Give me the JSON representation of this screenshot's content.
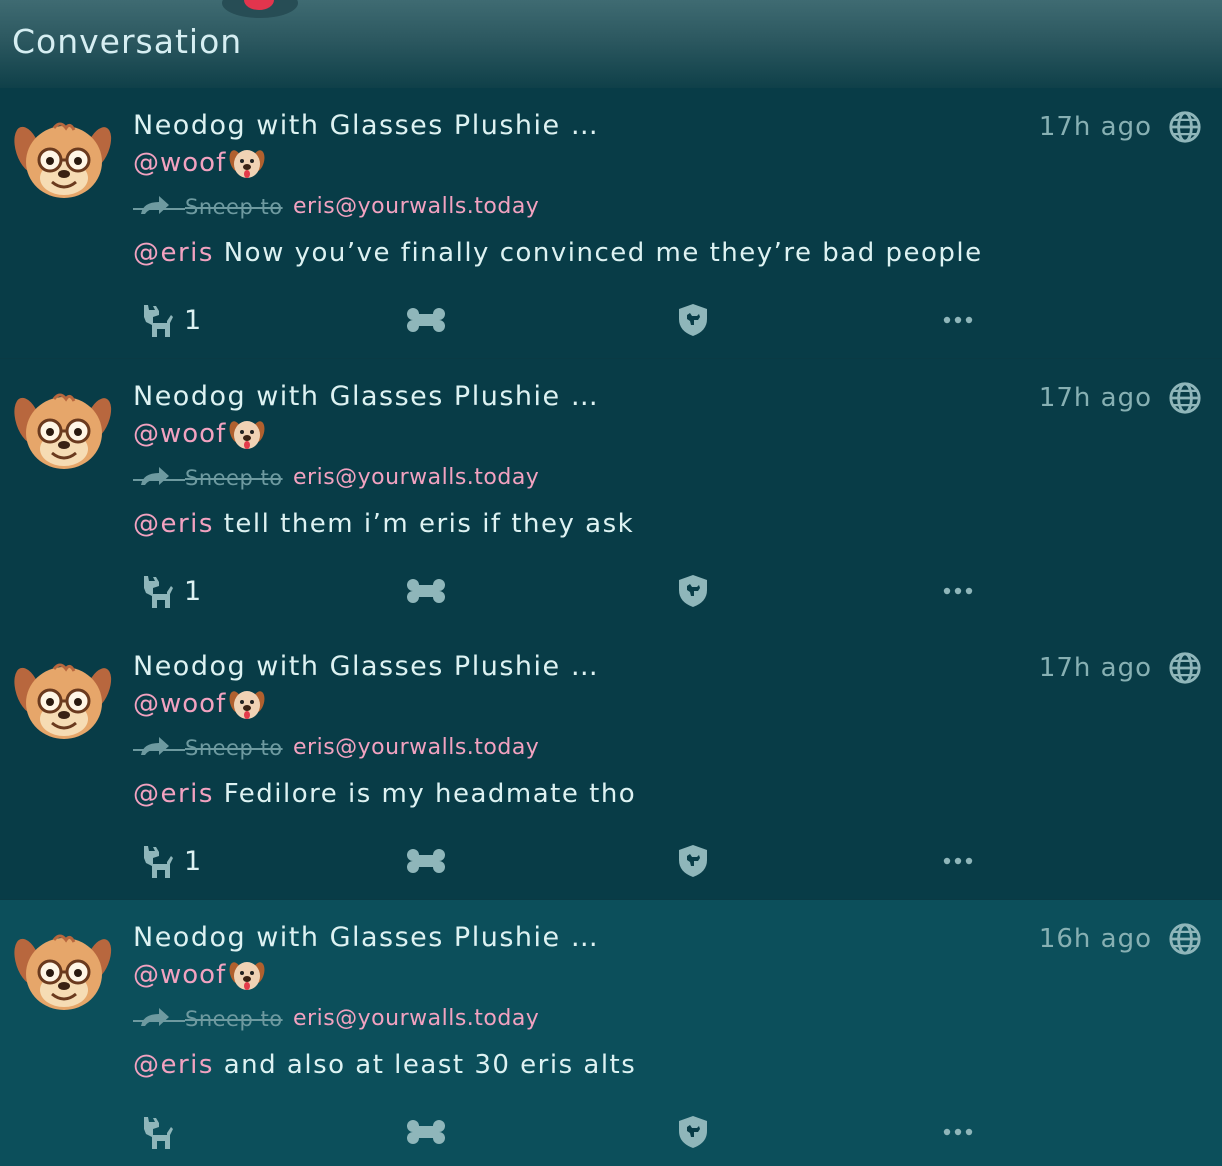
{
  "header": {
    "title": "Conversation"
  },
  "colors": {
    "accent_pink": "#f2a2c0",
    "text": "#ddf2f2",
    "muted": "#87b0b3",
    "bg": "#083c47",
    "focused_bg": "#0c4f5b"
  },
  "statuses": [
    {
      "display_name": "Neodog with Glasses Plushie …",
      "handle": "@woof",
      "handle_emoji": "dog-face-emoji",
      "time": "17h ago",
      "visibility_icon": "globe-icon",
      "reply_label": "Sneep to",
      "reply_target": "eris@yourwalls.today",
      "mention": "@eris",
      "text": " Now you’ve finally convinced me they’re bad people",
      "dog_count": "1",
      "focused": false
    },
    {
      "display_name": "Neodog with Glasses Plushie …",
      "handle": "@woof",
      "handle_emoji": "dog-face-emoji",
      "time": "17h ago",
      "visibility_icon": "globe-icon",
      "reply_label": "Sneep to",
      "reply_target": "eris@yourwalls.today",
      "mention": "@eris",
      "text": " tell them i’m eris if they ask",
      "dog_count": "1",
      "focused": false
    },
    {
      "display_name": "Neodog with Glasses Plushie …",
      "handle": "@woof",
      "handle_emoji": "dog-face-emoji",
      "time": "17h ago",
      "visibility_icon": "globe-icon",
      "reply_label": "Sneep to",
      "reply_target": "eris@yourwalls.today",
      "mention": "@eris",
      "text": " Fedilore is my headmate tho",
      "dog_count": "1",
      "focused": false
    },
    {
      "display_name": "Neodog with Glasses Plushie …",
      "handle": "@woof",
      "handle_emoji": "dog-face-emoji",
      "time": "16h ago",
      "visibility_icon": "globe-icon",
      "reply_label": "Sneep to",
      "reply_target": "eris@yourwalls.today",
      "mention": "@eris",
      "text": " and also at least 30 eris alts",
      "dog_count": "",
      "focused": true
    }
  ]
}
